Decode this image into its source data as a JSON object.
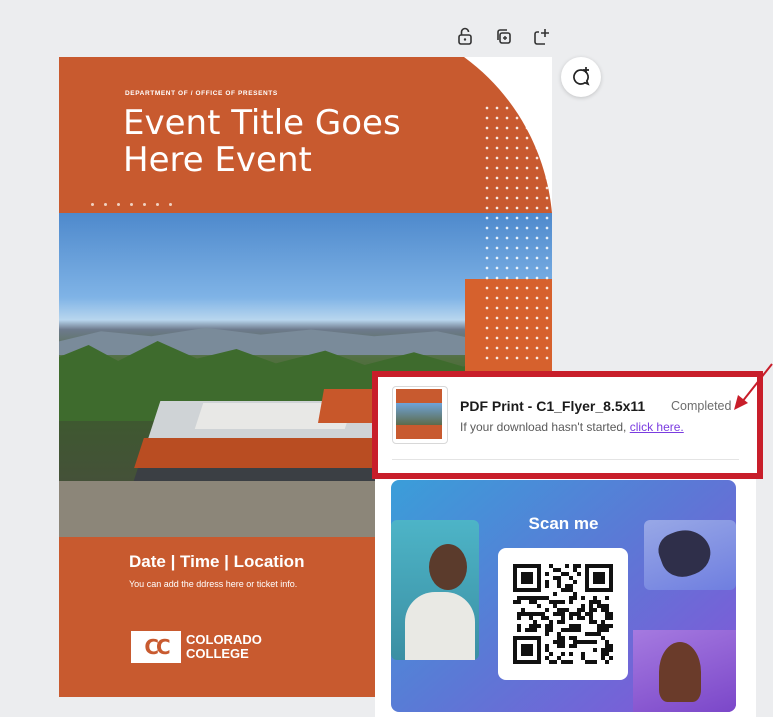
{
  "flyer": {
    "department": "DEPARTMENT OF / OFFICE OF PRESENTS",
    "title": "Event Title Goes Here Event",
    "date_time_location": "Date | Time | Location",
    "address_hint": "You can add the ddress here or ticket info.",
    "logo_mark": "CC",
    "logo_line1": "COLORADO",
    "logo_line2": "COLLEGE"
  },
  "promo": {
    "scan_label": "Scan me"
  },
  "notification": {
    "title": "PDF Print - C1_Flyer_8.5x11",
    "status": "Completed",
    "message": "If your download hasn't started, ",
    "link_text": "click here."
  },
  "colors": {
    "brand_orange": "#c85a2f",
    "highlight_red": "#c81e2a",
    "link_purple": "#7a3ce0"
  }
}
